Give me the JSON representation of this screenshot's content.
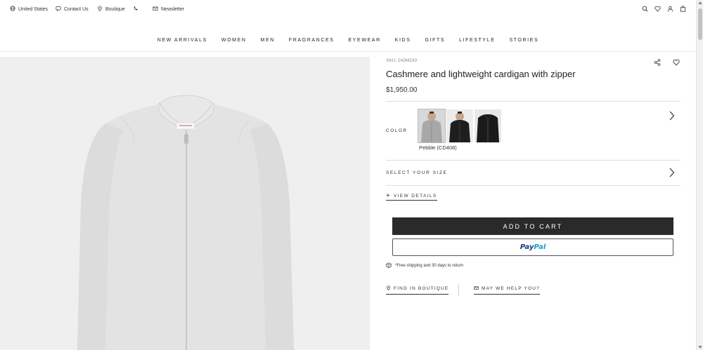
{
  "topbar": {
    "country": "United States",
    "contact": "Contact Us",
    "boutique": "Boutique",
    "newsletter": "Newsletter"
  },
  "icons": {
    "header_right": [
      "search-icon",
      "heart-icon",
      "user-icon",
      "bag-icon"
    ]
  },
  "nav": {
    "items": [
      "NEW ARRIVALS",
      "WOMEN",
      "MEN",
      "FRAGRANCES",
      "EYEWEAR",
      "KIDS",
      "GIFTS",
      "LIFESTYLE",
      "STORIES"
    ]
  },
  "product": {
    "sku": "SKU: 242M230",
    "title": "Cashmere and lightweight cardigan with zipper",
    "price": "$1,950.00",
    "color_label": "COLOR",
    "selected_color": "Pebble (CD408)",
    "swatches": [
      "Pebble",
      "Black",
      "Black"
    ],
    "size_label": "SELECT YOUR SIZE",
    "details_label": "VIEW DETAILS",
    "add_to_cart": "ADD TO CART",
    "paypal_pay": "Pay",
    "paypal_pal": "Pal",
    "shipping_note": "*Free shipping and 30 days to return",
    "find_boutique": "FIND IN BOUTIQUE",
    "help": "MAY WE HELP YOU?"
  },
  "colors": {
    "add_to_cart_bg": "#2a2a2a",
    "paypal_blue_dark": "#253b80",
    "paypal_blue_light": "#179bd7",
    "image_bg": "#efefef"
  }
}
